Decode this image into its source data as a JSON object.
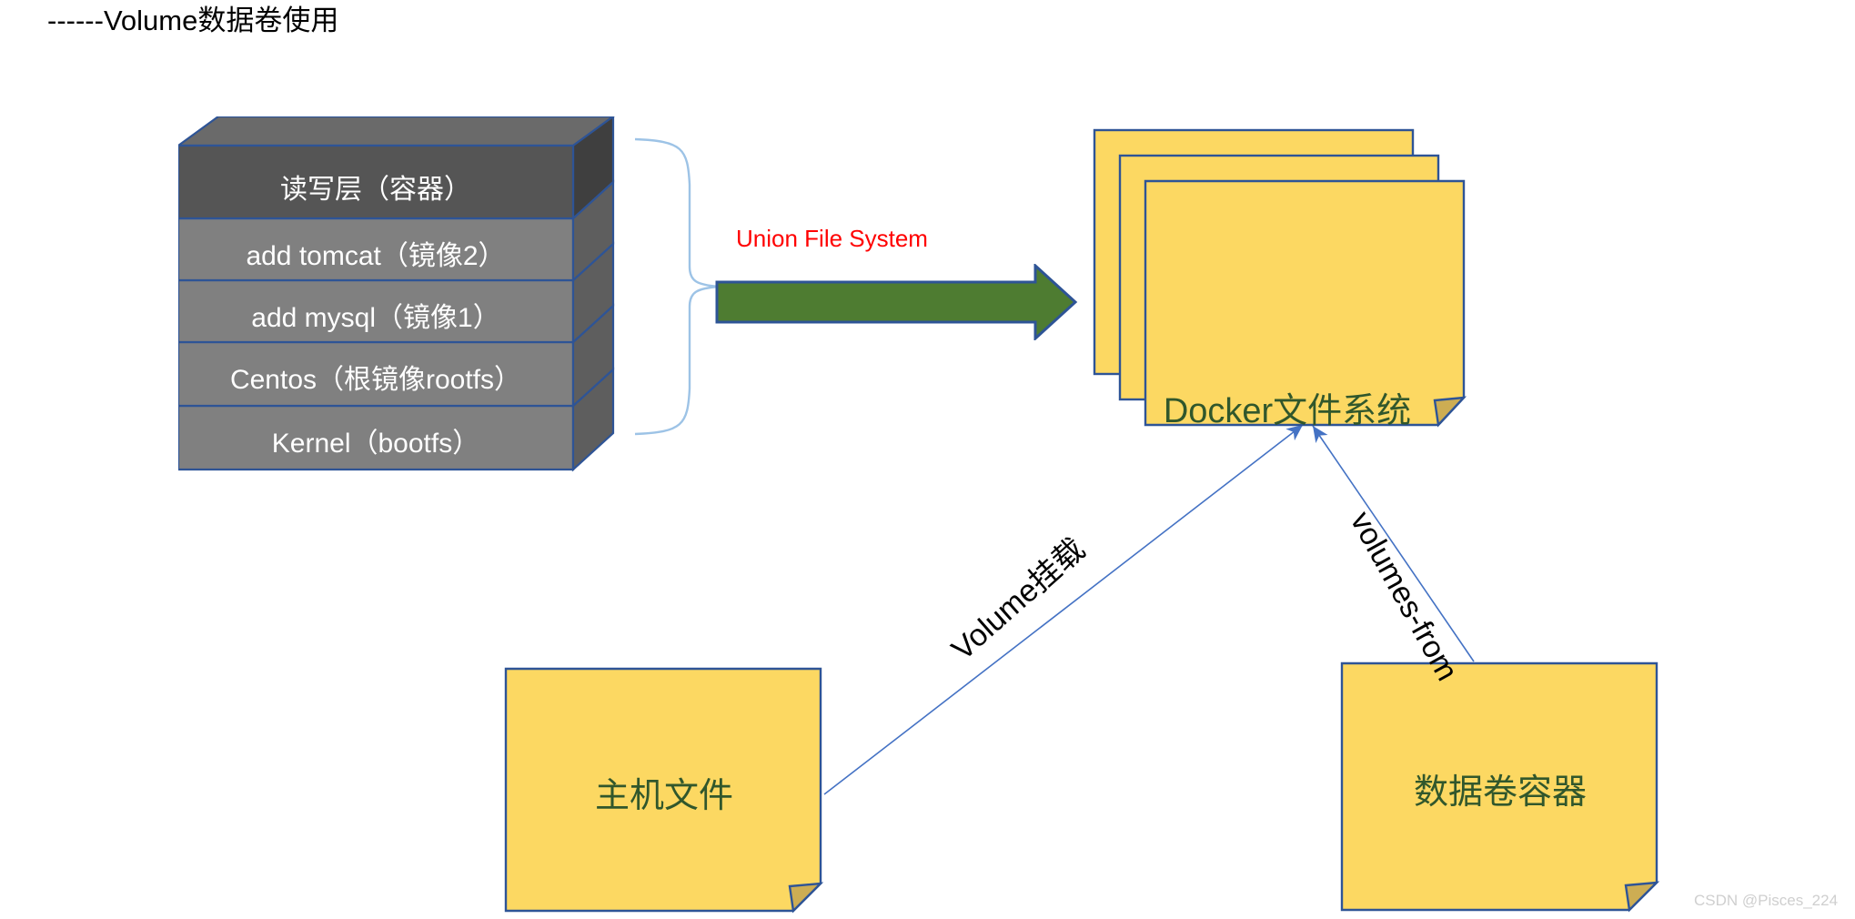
{
  "title": "------Volume数据卷使用",
  "layer_stack": {
    "name": "docker-image-layer-stack",
    "layers": [
      {
        "id": "rw-layer",
        "label": "读写层（容器）",
        "fill": "#555555",
        "side": "#3f3f3f",
        "top": "#6a6a6a"
      },
      {
        "id": "tomcat-layer",
        "label": "add tomcat（镜像2）",
        "fill": "#808080",
        "side": "#5e5e5e",
        "top": "#8f8f8f"
      },
      {
        "id": "mysql-layer",
        "label": "add mysql（镜像1）",
        "fill": "#808080",
        "side": "#5e5e5e",
        "top": "#8f8f8f"
      },
      {
        "id": "centos-layer",
        "label": "Centos（根镜像rootfs）",
        "fill": "#808080",
        "side": "#5e5e5e",
        "top": "#8f8f8f"
      },
      {
        "id": "kernel-layer",
        "label": "Kernel（bootfs）",
        "fill": "#808080",
        "side": "#5e5e5e",
        "top": "#8f8f8f"
      }
    ],
    "border_color": "#2e5496"
  },
  "union_file_system": {
    "label": "Union File System",
    "label_color": "#ff0000",
    "arrow_fill": "#4e7c31",
    "arrow_border": "#2e5496",
    "brace_color": "#9dc3e6"
  },
  "docker_fs": {
    "label": "Docker文件系统",
    "card_fill": "#fcd862",
    "card_border": "#2e5496",
    "fold_fill": "#cdad53",
    "text_color": "#31572c",
    "card_count": 3
  },
  "host_file": {
    "label": "主机文件",
    "card_fill": "#fcd862",
    "card_border": "#2e5496",
    "fold_fill": "#cdad53",
    "text_color": "#31572c"
  },
  "volume_container": {
    "label": "数据卷容器",
    "card_fill": "#fcd862",
    "card_border": "#2e5496",
    "fold_fill": "#cdad53",
    "text_color": "#31572c"
  },
  "connectors": {
    "volume_mount_label": "Volume挂载",
    "volumes_from_label": "volumes-from",
    "line_color": "#4472c4"
  },
  "watermark": "CSDN @Pisces_224"
}
